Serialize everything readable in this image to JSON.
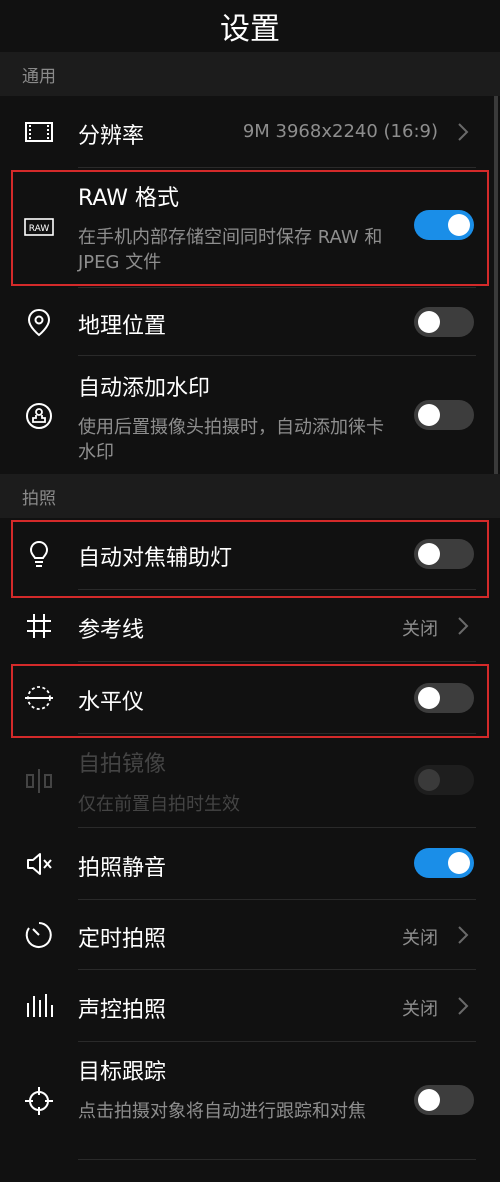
{
  "header": {
    "title": "设置"
  },
  "sections": {
    "general": "通用",
    "photo": "拍照"
  },
  "rows": {
    "resolution": {
      "title": "分辨率",
      "value": "9M 3968x2240 (16:9)"
    },
    "raw": {
      "title": "RAW 格式",
      "subtitle": "在手机内部存储空间同时保存 RAW 和 JPEG 文件",
      "toggle": true
    },
    "location": {
      "title": "地理位置",
      "toggle": false
    },
    "watermark": {
      "title": "自动添加水印",
      "subtitle": "使用后置摄像头拍摄时，自动添加徕卡水印",
      "toggle": false
    },
    "af_light": {
      "title": "自动对焦辅助灯",
      "toggle": false
    },
    "grid": {
      "title": "参考线",
      "value": "关闭"
    },
    "level": {
      "title": "水平仪",
      "toggle": false
    },
    "mirror": {
      "title": "自拍镜像",
      "subtitle": "仅在前置自拍时生效",
      "toggle": false,
      "disabled": true
    },
    "mute": {
      "title": "拍照静音",
      "toggle": true
    },
    "timer": {
      "title": "定时拍照",
      "value": "关闭"
    },
    "voice": {
      "title": "声控拍照",
      "value": "关闭"
    },
    "tracking": {
      "title": "目标跟踪",
      "subtitle": "点击拍摄对象将自动进行跟踪和对焦",
      "toggle": false
    }
  },
  "colors": {
    "accent": "#1a8ee8",
    "highlight": "#d42a2a"
  }
}
